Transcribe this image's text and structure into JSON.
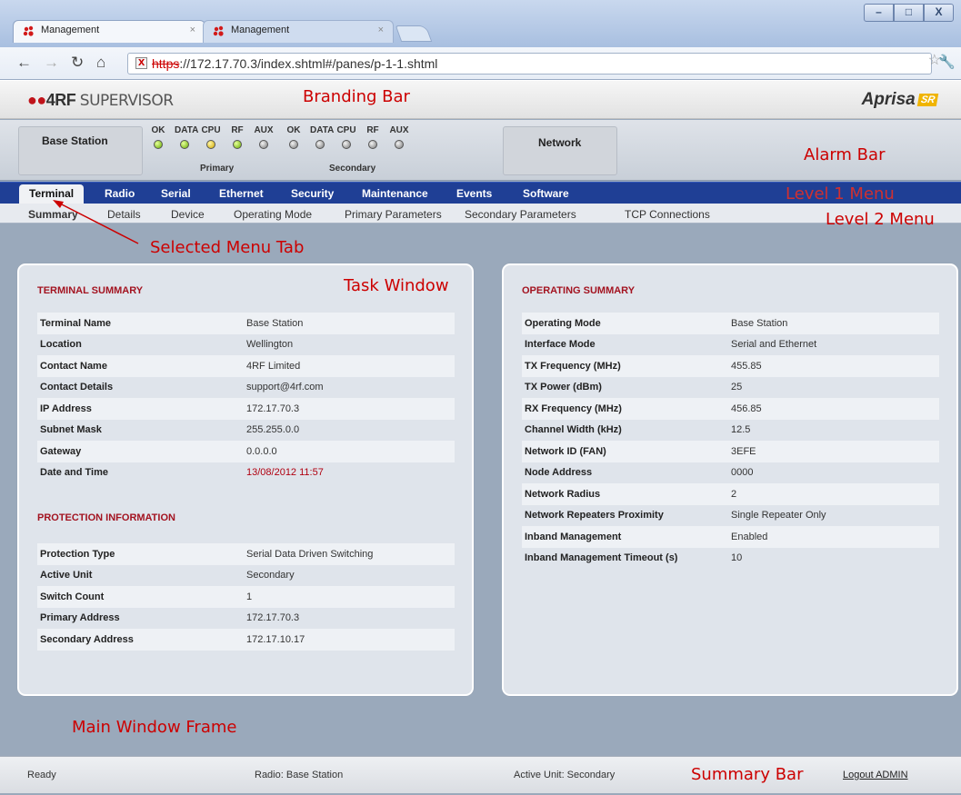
{
  "browser": {
    "tabs": [
      {
        "label": "Management",
        "active": true
      },
      {
        "label": "Management",
        "active": false
      }
    ],
    "close_glyph": "×",
    "url_scheme": "https",
    "url_rest": "://172.17.70.3/index.shtml#/panes/p-1-1.shtml",
    "window_controls": [
      "–",
      "□",
      "X"
    ],
    "nav_icons": [
      "back-icon",
      "forward-icon",
      "reload-icon",
      "home-icon",
      "star-icon",
      "wrench-icon"
    ]
  },
  "branding": {
    "logo_mark": "4RF",
    "logo_text": "SUPERVISOR",
    "product": "Aprisa",
    "product_badge": "SR"
  },
  "alarm": {
    "station": "Base Station",
    "network": "Network",
    "led_labels": [
      "OK",
      "DATA",
      "CPU",
      "RF",
      "AUX"
    ],
    "primary": {
      "label": "Primary",
      "leds": [
        "green",
        "green",
        "yellow",
        "green",
        "grey"
      ]
    },
    "secondary": {
      "label": "Secondary",
      "leds": [
        "grey",
        "grey",
        "grey",
        "grey",
        "grey"
      ]
    }
  },
  "menu1": [
    "Terminal",
    "Radio",
    "Serial",
    "Ethernet",
    "Security",
    "Maintenance",
    "Events",
    "Software"
  ],
  "menu2": [
    "Summary",
    "Details",
    "Device",
    "Operating Mode",
    "Primary Parameters",
    "Secondary Parameters",
    "TCP Connections"
  ],
  "terminal_summary": {
    "title": "TERMINAL SUMMARY",
    "rows": [
      {
        "k": "Terminal Name",
        "v": "Base Station"
      },
      {
        "k": "Location",
        "v": "Wellington"
      },
      {
        "k": "Contact Name",
        "v": "4RF Limited"
      },
      {
        "k": "Contact Details",
        "v": "support@4rf.com"
      },
      {
        "k": "IP Address",
        "v": "172.17.70.3"
      },
      {
        "k": "Subnet Mask",
        "v": "255.255.0.0"
      },
      {
        "k": "Gateway",
        "v": "0.0.0.0"
      },
      {
        "k": "Date and Time",
        "v": "13/08/2012 11:57"
      }
    ]
  },
  "protection_info": {
    "title": "PROTECTION INFORMATION",
    "rows": [
      {
        "k": "Protection Type",
        "v": "Serial Data Driven Switching"
      },
      {
        "k": "Active Unit",
        "v": "Secondary"
      },
      {
        "k": "Switch Count",
        "v": "1"
      },
      {
        "k": "Primary Address",
        "v": "172.17.70.3"
      },
      {
        "k": "Secondary Address",
        "v": "172.17.10.17"
      }
    ]
  },
  "operating_summary": {
    "title": "OPERATING SUMMARY",
    "rows": [
      {
        "k": "Operating Mode",
        "v": "Base Station"
      },
      {
        "k": "Interface Mode",
        "v": "Serial and Ethernet"
      },
      {
        "k": "TX Frequency (MHz)",
        "v": "455.85"
      },
      {
        "k": "TX Power (dBm)",
        "v": "25"
      },
      {
        "k": "RX Frequency (MHz)",
        "v": "456.85"
      },
      {
        "k": "Channel Width (kHz)",
        "v": "12.5"
      },
      {
        "k": "Network ID (FAN)",
        "v": "3EFE"
      },
      {
        "k": "Node Address",
        "v": "0000"
      },
      {
        "k": "Network Radius",
        "v": "2"
      },
      {
        "k": "Network Repeaters Proximity",
        "v": "Single Repeater Only"
      },
      {
        "k": "Inband Management",
        "v": "Enabled"
      },
      {
        "k": "Inband Management Timeout (s)",
        "v": "10"
      }
    ]
  },
  "status_bar": {
    "state": "Ready",
    "radio": "Radio: Base Station",
    "active_unit": "Active Unit: Secondary",
    "logout": "Logout ADMIN"
  },
  "annotations": {
    "branding_bar": "Branding Bar",
    "alarm_bar": "Alarm Bar",
    "level1": "Level 1 Menu",
    "level2": "Level 2 Menu",
    "selected_tab": "Selected Menu Tab",
    "task_window": "Task Window",
    "main_frame": "Main Window Frame",
    "summary_bar": "Summary Bar"
  },
  "colors": {
    "menu1_bg": "#1f3f95",
    "page_bg": "#9aa9bb",
    "section_title": "#a31320",
    "annotation": "#cc0000"
  }
}
